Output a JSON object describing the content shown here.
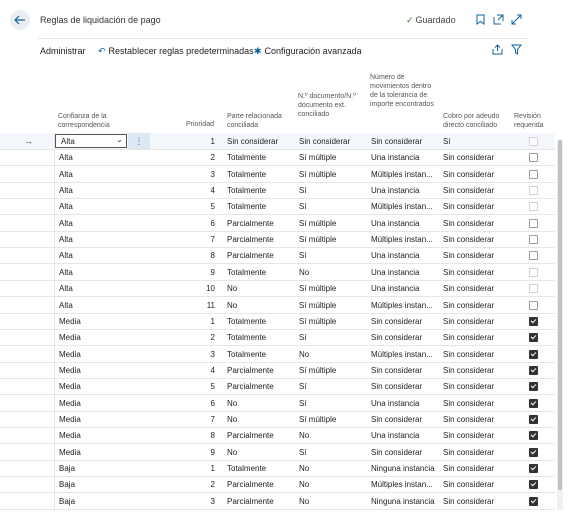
{
  "header": {
    "title": "Reglas de liquidación de pago",
    "saved_label": "Guardado",
    "back_icon": "arrow-left-icon",
    "bookmark_icon": "bookmark-icon",
    "open_new_icon": "open-new-window-icon",
    "expand_icon": "expand-icon"
  },
  "actions": {
    "manage": "Administrar",
    "reset": "Restablecer reglas predeterminadas",
    "advanced": "Configuración avanzada",
    "share_icon": "share-icon",
    "filter_icon": "filter-icon"
  },
  "columns": {
    "confidence": "Confianza de la correspondencia",
    "priority": "Prioridad",
    "related_party": "Parte relacionada conciliada",
    "doc_no": "N.º documento/N.º documento ext. conciliado",
    "movements": "Número de movimientos dentro de la tolerancia de importe encontrados",
    "direct_debit": "Cobro por adeudo directo conciliado",
    "review": "Revisión requerida"
  },
  "rows": [
    {
      "c": "Alta",
      "p": "1",
      "r": "Sin considerar",
      "d": "Sin considerar",
      "m": "Sin considerar",
      "dd": "Sí",
      "rev": false
    },
    {
      "c": "Alta",
      "p": "2",
      "r": "Totalmente",
      "d": "Sí múltiple",
      "m": "Una instancia",
      "dd": "Sin considerar",
      "rev": false
    },
    {
      "c": "Alta",
      "p": "3",
      "r": "Totalmente",
      "d": "Sí múltiple",
      "m": "Múltiples instan...",
      "dd": "Sin considerar",
      "rev": false
    },
    {
      "c": "Alta",
      "p": "4",
      "r": "Totalmente",
      "d": "Sí",
      "m": "Una instancia",
      "dd": "Sin considerar",
      "rev": false
    },
    {
      "c": "Alta",
      "p": "5",
      "r": "Totalmente",
      "d": "Sí",
      "m": "Múltiples instan...",
      "dd": "Sin considerar",
      "rev": false
    },
    {
      "c": "Alta",
      "p": "6",
      "r": "Parcialmente",
      "d": "Sí múltiple",
      "m": "Una instancia",
      "dd": "Sin considerar",
      "rev": false
    },
    {
      "c": "Alta",
      "p": "7",
      "r": "Parcialmente",
      "d": "Sí múltiple",
      "m": "Múltiples instan...",
      "dd": "Sin considerar",
      "rev": false
    },
    {
      "c": "Alta",
      "p": "8",
      "r": "Parcialmente",
      "d": "Sí",
      "m": "Una instancia",
      "dd": "Sin considerar",
      "rev": false
    },
    {
      "c": "Alta",
      "p": "9",
      "r": "Totalmente",
      "d": "No",
      "m": "Una instancia",
      "dd": "Sin considerar",
      "rev": false
    },
    {
      "c": "Alta",
      "p": "10",
      "r": "No",
      "d": "Sí múltiple",
      "m": "Una instancia",
      "dd": "Sin considerar",
      "rev": false
    },
    {
      "c": "Alta",
      "p": "11",
      "r": "No",
      "d": "Sí múltiple",
      "m": "Múltiples instan...",
      "dd": "Sin considerar",
      "rev": false
    },
    {
      "c": "Media",
      "p": "1",
      "r": "Totalmente",
      "d": "Sí múltiple",
      "m": "Sin considerar",
      "dd": "Sin considerar",
      "rev": true
    },
    {
      "c": "Media",
      "p": "2",
      "r": "Totalmente",
      "d": "Sí",
      "m": "Sin considerar",
      "dd": "Sin considerar",
      "rev": true
    },
    {
      "c": "Media",
      "p": "3",
      "r": "Totalmente",
      "d": "No",
      "m": "Múltiples instan...",
      "dd": "Sin considerar",
      "rev": true
    },
    {
      "c": "Media",
      "p": "4",
      "r": "Parcialmente",
      "d": "Sí múltiple",
      "m": "Sin considerar",
      "dd": "Sin considerar",
      "rev": true
    },
    {
      "c": "Media",
      "p": "5",
      "r": "Parcialmente",
      "d": "Sí",
      "m": "Sin considerar",
      "dd": "Sin considerar",
      "rev": true
    },
    {
      "c": "Media",
      "p": "6",
      "r": "No",
      "d": "Sí",
      "m": "Una instancia",
      "dd": "Sin considerar",
      "rev": true
    },
    {
      "c": "Media",
      "p": "7",
      "r": "No",
      "d": "Sí múltiple",
      "m": "Sin considerar",
      "dd": "Sin considerar",
      "rev": true
    },
    {
      "c": "Media",
      "p": "8",
      "r": "Parcialmente",
      "d": "No",
      "m": "Una instancia",
      "dd": "Sin considerar",
      "rev": true
    },
    {
      "c": "Media",
      "p": "9",
      "r": "No",
      "d": "Sí",
      "m": "Sin considerar",
      "dd": "Sin considerar",
      "rev": true
    },
    {
      "c": "Baja",
      "p": "1",
      "r": "Totalmente",
      "d": "No",
      "m": "Ninguna instancia",
      "dd": "Sin considerar",
      "rev": true
    },
    {
      "c": "Baja",
      "p": "2",
      "r": "Parcialmente",
      "d": "No",
      "m": "Múltiples instan...",
      "dd": "Sin considerar",
      "rev": true
    },
    {
      "c": "Baja",
      "p": "3",
      "r": "Parcialmente",
      "d": "No",
      "m": "Ninguna instancia",
      "dd": "Sin considerar",
      "rev": true
    }
  ],
  "selected_row_marker": "→",
  "colors": {
    "accent": "#0e639c",
    "saved": "#2d7d2d"
  }
}
